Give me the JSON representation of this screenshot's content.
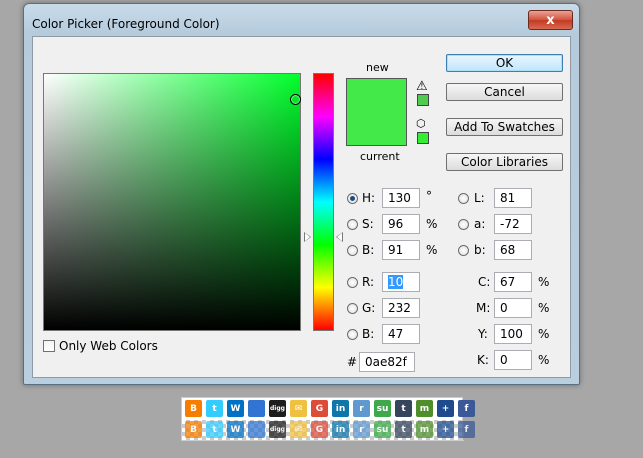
{
  "window": {
    "title": "Color Picker (Foreground Color)",
    "close_label": "x"
  },
  "swatch": {
    "new_label": "new",
    "current_label": "current",
    "color": "#43e948"
  },
  "buttons": {
    "ok": "OK",
    "cancel": "Cancel",
    "add_to_swatches": "Add To Swatches",
    "color_libraries": "Color Libraries"
  },
  "hsb": {
    "h_label": "H:",
    "h_value": "130",
    "h_unit": "°",
    "s_label": "S:",
    "s_value": "96",
    "s_unit": "%",
    "b_label": "B:",
    "b_value": "91",
    "b_unit": "%"
  },
  "rgb": {
    "r_label": "R:",
    "r_value": "10",
    "g_label": "G:",
    "g_value": "232",
    "b_label": "B:",
    "b_value": "47"
  },
  "lab": {
    "l_label": "L:",
    "l_value": "81",
    "a_label": "a:",
    "a_value": "-72",
    "b_label": "b:",
    "b_value": "68"
  },
  "cmyk": {
    "c_label": "C:",
    "c_value": "67",
    "m_label": "M:",
    "m_value": "0",
    "y_label": "Y:",
    "y_value": "100",
    "k_label": "K:",
    "k_value": "0",
    "unit": "%"
  },
  "hex": {
    "label": "#",
    "value": "0ae82f"
  },
  "web_colors": {
    "label": "Only Web Colors",
    "checked": false
  },
  "share_icons": [
    {
      "name": "blogger",
      "glyph": "B",
      "color": "#f57d00"
    },
    {
      "name": "twitter",
      "glyph": "t",
      "color": "#33ccff"
    },
    {
      "name": "windows-live",
      "glyph": "W",
      "color": "#0072c6"
    },
    {
      "name": "delicious",
      "glyph": "",
      "color": "#3274d1"
    },
    {
      "name": "digg",
      "glyph": "digg",
      "color": "#1d1d1d"
    },
    {
      "name": "email",
      "glyph": "✉",
      "color": "#f0c040"
    },
    {
      "name": "google-bookmarks",
      "glyph": "G",
      "color": "#dd4b39"
    },
    {
      "name": "linkedin",
      "glyph": "in",
      "color": "#0e76a8"
    },
    {
      "name": "reddit",
      "glyph": "r",
      "color": "#5f99cf"
    },
    {
      "name": "stumbleupon",
      "glyph": "su",
      "color": "#3da94a"
    },
    {
      "name": "tumblr",
      "glyph": "t",
      "color": "#35465c"
    },
    {
      "name": "myspace",
      "glyph": "m",
      "color": "#4e8f2b"
    },
    {
      "name": "addthis",
      "glyph": "+",
      "color": "#1e4b8e"
    },
    {
      "name": "facebook",
      "glyph": "f",
      "color": "#3b5998"
    }
  ]
}
